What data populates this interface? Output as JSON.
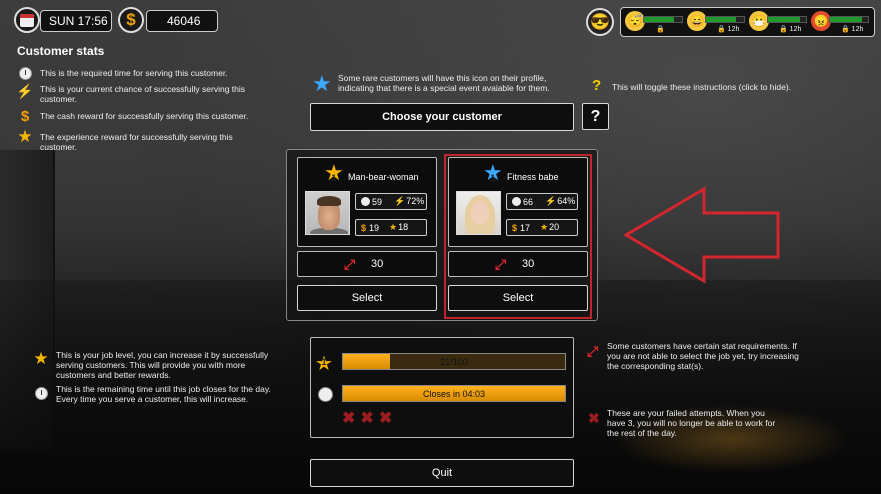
{
  "hud": {
    "day_time": "SUN 17:56",
    "money": "46046",
    "colors": {
      "accent_gold": "#f2a100",
      "bar_green": "#1f9a2b",
      "highlight_red": "#c0252b"
    }
  },
  "moods": [
    {
      "icon": "sleepy-face-icon",
      "level": 0.8,
      "tag": ""
    },
    {
      "icon": "happy-face-icon",
      "level": 0.8,
      "tag": "12h"
    },
    {
      "icon": "sick-face-icon",
      "level": 0.85,
      "tag": "12h"
    },
    {
      "icon": "angry-face-icon",
      "level": 0.85,
      "tag": "12h"
    }
  ],
  "instructions": {
    "title": "Customer stats",
    "time": "This is the required time for serving this customer.",
    "chance": "This is your current chance of successfully serving this customer.",
    "cash": "The cash reward for successfully serving this customer.",
    "xp": "The experience reward for successfully serving this customer.",
    "rare": "Some rare customers will have this icon on their profile, indicating that there is a special event avaiable for them.",
    "toggle": "This will toggle these instructions (click to hide).",
    "job_level": "This is your job level, you can increase it by successfully serving customers. This will provide you with more customers and better rewards.",
    "remaining": "This is the remaining time until this job closes for the day. Every time you serve a customer, this will increase.",
    "requirements": "Some customers have certain stat requirements. If you are not able to select the job yet, try increasing the corresponding stat(s).",
    "failed": "These are your failed attempts. When you have 3, you will no longer be able to work for the rest of the day."
  },
  "buttons": {
    "choose": "Choose your customer",
    "help": "?",
    "select": "Select",
    "quit": "Quit"
  },
  "customers": [
    {
      "level": "1",
      "name": "Man-bear-woman",
      "time": "59",
      "chance": "72%",
      "cash": "19",
      "xp": "18",
      "requirement": "30",
      "star_color": "#f5b400"
    },
    {
      "level": "1",
      "name": "Fitness babe",
      "time": "66",
      "chance": "64%",
      "cash": "17",
      "xp": "20",
      "requirement": "30",
      "star_color": "#3aa8ff"
    }
  ],
  "job": {
    "level": "1",
    "xp_text": "21/100",
    "xp_fraction": 0.21,
    "closes_text": "Closes in 04:03",
    "closes_fraction": 1.0,
    "failed_attempts": "✖✖✖"
  }
}
